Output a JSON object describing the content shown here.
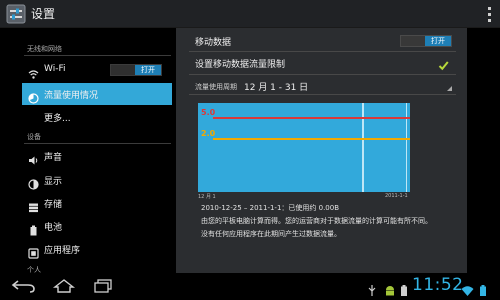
{
  "action_bar": {
    "title": "设置"
  },
  "sidebar": {
    "sections": [
      {
        "label": "无线和网络"
      },
      {
        "label": "设备"
      },
      {
        "label": "个人"
      }
    ],
    "items": [
      {
        "label": "Wi-Fi",
        "toggle": "打开"
      },
      {
        "label": "流量使用情况",
        "selected": true
      },
      {
        "label": "更多..."
      },
      {
        "label": "声音"
      },
      {
        "label": "显示"
      },
      {
        "label": "存储"
      },
      {
        "label": "电池"
      },
      {
        "label": "应用程序"
      }
    ]
  },
  "detail": {
    "mobile_data": {
      "label": "移动数据",
      "toggle": "打开"
    },
    "set_limit": {
      "label": "设置移动数据流量限制",
      "checked": true
    },
    "cycle": {
      "label": "流量使用周期",
      "value": "12 月 1 - 31 日"
    },
    "chart": {
      "limit_label": "5.0",
      "warning_label": "2.0",
      "x_start": "12 月 1",
      "x_end": "2011-1-1"
    },
    "usage_summary": "2010-12-25 – 2011-1-1：已使用约 0.00B",
    "note_line1": "由您的平板电脑计算而得。您的运营商对于数据流量的计算可能有所不同。",
    "note_line2": "没有任何应用程序在此期间产生过数据流量。"
  },
  "status_bar": {
    "time": "11:52"
  },
  "colors": {
    "accent": "#33b5e5",
    "chart_bg": "#32a9db",
    "limit": "#d93a3a",
    "warning": "#f2a900"
  }
}
